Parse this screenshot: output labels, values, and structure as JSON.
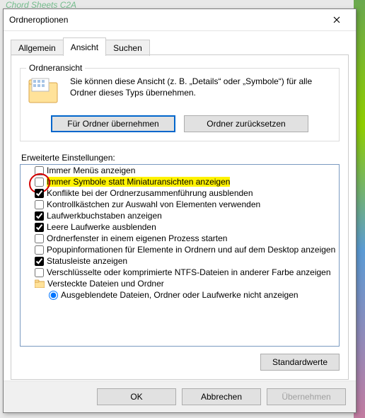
{
  "behind_window_title": "Chord Sheets C2A",
  "dialog": {
    "title": "Ordneroptionen",
    "tabs": {
      "general": "Allgemein",
      "view": "Ansicht",
      "search": "Suchen",
      "active": "view"
    },
    "folderview": {
      "group_label": "Ordneransicht",
      "text": "Sie können diese Ansicht (z. B. „Details“ oder „Symbole“) für alle Ordner dieses Typs übernehmen.",
      "apply_btn": "Für Ordner übernehmen",
      "reset_btn": "Ordner zurücksetzen"
    },
    "advanced": {
      "label": "Erweiterte Einstellungen:",
      "items": [
        {
          "kind": "check",
          "checked": false,
          "label": "Immer Menüs anzeigen",
          "level": 1
        },
        {
          "kind": "check",
          "checked": false,
          "label": "Immer Symbole statt Miniaturansichten anzeigen",
          "level": 1,
          "highlight": true,
          "red_circle": true
        },
        {
          "kind": "check",
          "checked": true,
          "label": "Konflikte bei der Ordnerzusammenführung ausblenden",
          "level": 1
        },
        {
          "kind": "check",
          "checked": false,
          "label": "Kontrollkästchen zur Auswahl von Elementen verwenden",
          "level": 1
        },
        {
          "kind": "check",
          "checked": true,
          "label": "Laufwerkbuchstaben anzeigen",
          "level": 1
        },
        {
          "kind": "check",
          "checked": true,
          "label": "Leere Laufwerke ausblenden",
          "level": 1
        },
        {
          "kind": "check",
          "checked": false,
          "label": "Ordnerfenster in einem eigenen Prozess starten",
          "level": 1
        },
        {
          "kind": "check",
          "checked": false,
          "label": "Popupinformationen für Elemente in Ordnern und auf dem Desktop anzeigen",
          "level": 1
        },
        {
          "kind": "check",
          "checked": true,
          "label": "Statusleiste anzeigen",
          "level": 1
        },
        {
          "kind": "check",
          "checked": false,
          "label": "Verschlüsselte oder komprimierte NTFS-Dateien in anderer Farbe anzeigen",
          "level": 1
        },
        {
          "kind": "folder",
          "label": "Versteckte Dateien und Ordner",
          "level": 1
        },
        {
          "kind": "radio",
          "checked": true,
          "label": "Ausgeblendete Dateien, Ordner oder Laufwerke nicht anzeigen",
          "level": 2
        }
      ],
      "defaults_btn": "Standardwerte"
    },
    "buttons": {
      "ok": "OK",
      "cancel": "Abbrechen",
      "apply": "Übernehmen"
    }
  }
}
